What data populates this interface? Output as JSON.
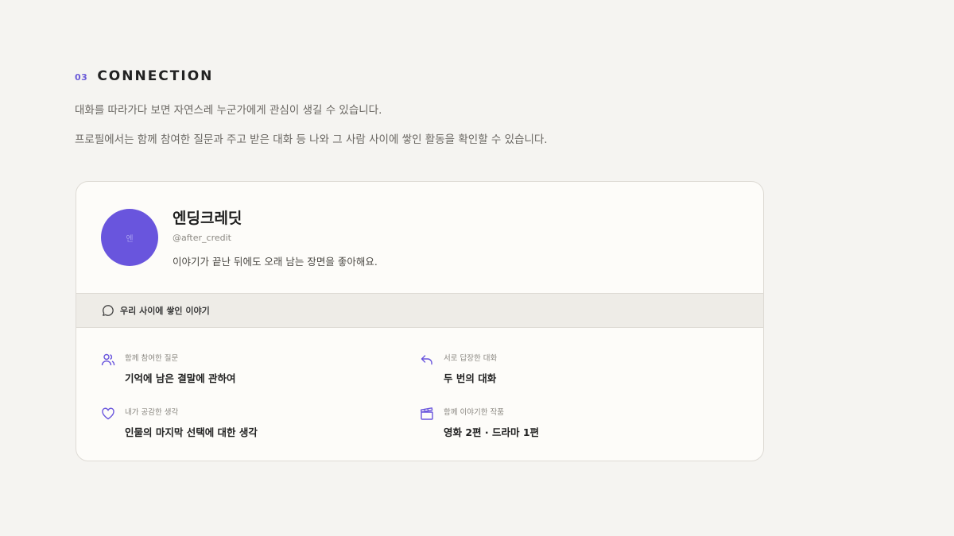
{
  "section": {
    "number": "03",
    "title": "CONNECTION",
    "desc1": "대화를 따라가다 보면 자연스레 누군가에게 관심이 생길 수 있습니다.",
    "desc2": "프로필에서는 함께 참여한 질문과 주고 받은 대화 등 나와 그 사람 사이에 쌓인 활동을 확인할 수 있습니다."
  },
  "profile": {
    "avatar_text": "엔",
    "name": "엔딩크레딧",
    "handle": "@after_credit",
    "bio": "이야기가 끝난 뒤에도 오래 남는 장면을 좋아해요."
  },
  "band": {
    "icon": "speech-bubble-icon",
    "label": "우리 사이에 쌓인 이야기"
  },
  "items": [
    {
      "icon": "people-icon",
      "label": "함께 참여한 질문",
      "value": "기억에 남은 결말에 관하여"
    },
    {
      "icon": "reply-arrow-icon",
      "label": "서로 답장한 대화",
      "value": "두 번의 대화"
    },
    {
      "icon": "heart-icon",
      "label": "내가 공감한 생각",
      "value": "인물의 마지막 선택에 대한 생각"
    },
    {
      "icon": "clapperboard-icon",
      "label": "함께 이야기한 작품",
      "value": "영화 2편 · 드라마 1편"
    }
  ],
  "colors": {
    "accent": "#6955dd",
    "background": "#f5f4f1",
    "card": "#fdfcf9"
  }
}
